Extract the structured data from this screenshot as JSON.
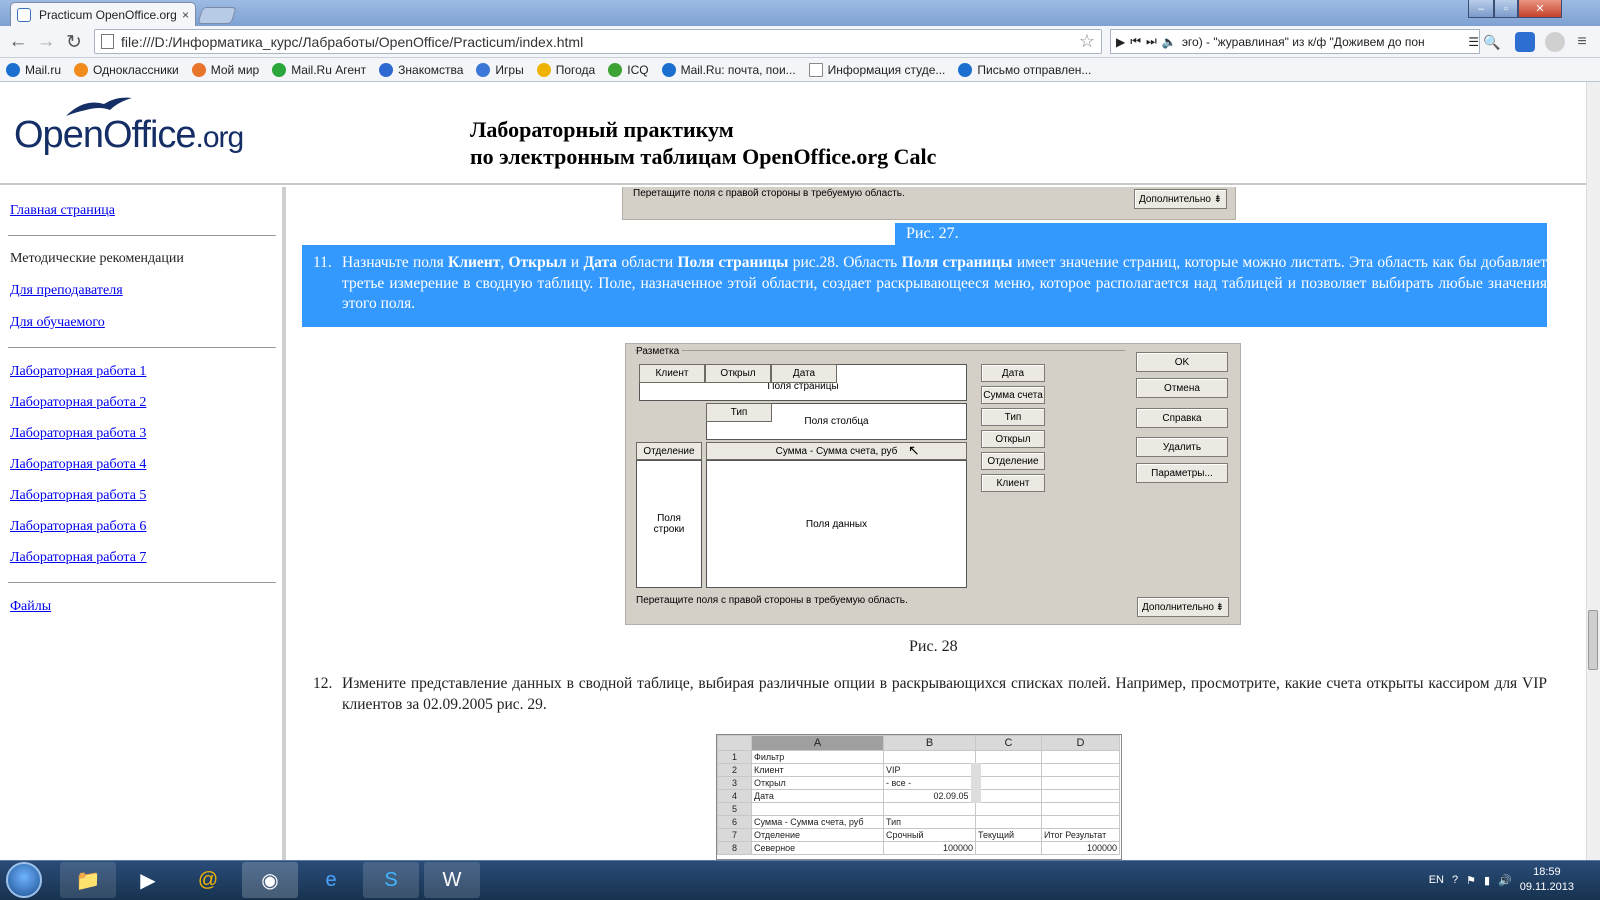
{
  "browser": {
    "tab_title": "Practicum OpenOffice.org",
    "tab_close": "×",
    "url": "file:///D:/Информатика_курс/Лабработы/OpenOffice/Practicum/index.html",
    "player_text": "эго) - \"журавлиная\" из к/ф \"Доживем до пон",
    "bookmarks": [
      {
        "label": "Mail.ru",
        "color": "#1a6fd1",
        "icon": "mail-icon"
      },
      {
        "label": "Одноклассники",
        "color": "#f08b1c",
        "icon": "ok-icon"
      },
      {
        "label": "Мой мир",
        "color": "#e9742b",
        "icon": "world-icon"
      },
      {
        "label": "Mail.Ru Агент",
        "color": "#2aa63a",
        "icon": "agent-icon"
      },
      {
        "label": "Знакомства",
        "color": "#2e6ad1",
        "icon": "at-icon"
      },
      {
        "label": "Игры",
        "color": "#3b77d8",
        "icon": "games-icon"
      },
      {
        "label": "Погода",
        "color": "#f0b400",
        "icon": "weather-icon"
      },
      {
        "label": "ICQ",
        "color": "#3da234",
        "icon": "icq-icon"
      },
      {
        "label": "Mail.Ru: почта, пои...",
        "color": "#1a6fd1",
        "icon": "mail-icon"
      },
      {
        "label": "Информация студе...",
        "color": "#ffffff",
        "icon": "page-icon"
      },
      {
        "label": "Письмо отправлен...",
        "color": "#1a6fd1",
        "icon": "mail-icon"
      }
    ]
  },
  "header": {
    "logo_word": "OpenOffice",
    "logo_suffix": ".org",
    "title_line1": "Лабораторный практикум",
    "title_line2": "по электронным таблицам OpenOffice.org Calc"
  },
  "sidebar": {
    "home": "Главная страница",
    "methodics": "Методические рекомендации",
    "teacher": "Для преподавателя",
    "student": "Для обучаемого",
    "labs": [
      "Лабораторная работа 1",
      "Лабораторная работа 2",
      "Лабораторная работа 3",
      "Лабораторная работа 4",
      "Лабораторная работа 5",
      "Лабораторная работа 6",
      "Лабораторная работа 7"
    ],
    "files": "Файлы"
  },
  "content": {
    "top_dialog_hint": "Перетащите поля с правой стороны в требуемую область.",
    "top_dialog_more": "Дополнительно",
    "caption27": "Рис. 27.",
    "item11_num": "11.",
    "item11_p1": "Назначьте поля ",
    "item11_b1": "Клиент",
    "item11_p2": ", ",
    "item11_b2": "Открыл",
    "item11_p3": " и ",
    "item11_b3": "Дата",
    "item11_p4": " области ",
    "item11_b4": "Поля страницы",
    "item11_p5": " рис.28. Область ",
    "item11_b5": "Поля страницы",
    "item11_p6": " имеет значение страниц, которые можно листать. Эта область как бы добавляет третье измерение в сводную таблицу. Поле, назначенное этой области, создает раскрывающееся меню, которое располагается над таблицей и позволяет выбирать любые значения этого поля.",
    "dialog": {
      "legend": "Разметка",
      "page_fields": [
        "Клиент",
        "Открыл",
        "Дата"
      ],
      "page_zone": "Поля страницы",
      "col_field": "Тип",
      "col_zone": "Поля столбца",
      "row_field": "Отделение",
      "data_field": "Сумма -  Сумма счета, руб",
      "row_zone_1": "Поля",
      "row_zone_2": "строки",
      "data_zone": "Поля данных",
      "available": [
        "Дата",
        "Сумма счета",
        "Тип",
        "Открыл",
        "Отделение",
        "Клиент"
      ],
      "ok": "OK",
      "cancel": "Отмена",
      "help": "Справка",
      "delete": "Удалить",
      "options": "Параметры...",
      "hint": "Перетащите поля с правой стороны в требуемую область.",
      "more": "Дополнительно"
    },
    "caption28": "Рис. 28",
    "item12_num": "12.",
    "item12_text": "Измените представление данных в сводной таблице, выбирая различные опции в раскрывающихся списках полей. Например, просмотрите, какие счета открыты кассиром для VIP клиентов за 02.09.2005 рис. 29.",
    "sheet": {
      "cols": [
        "A",
        "B",
        "C",
        "D"
      ],
      "rows": [
        [
          "1",
          "Фильтр",
          "",
          "",
          ""
        ],
        [
          "2",
          "Клиент",
          "VIP",
          "",
          ""
        ],
        [
          "3",
          "Открыл",
          "- все -",
          "",
          ""
        ],
        [
          "4",
          "Дата",
          "02.09.05",
          "",
          ""
        ],
        [
          "5",
          "",
          "",
          "",
          ""
        ],
        [
          "6",
          "Сумма -  Сумма счета, руб",
          "Тип",
          "",
          ""
        ],
        [
          "7",
          "Отделение",
          "Срочный",
          "Текущий",
          "Итог Результат"
        ],
        [
          "8",
          "Северное",
          "100000",
          "",
          "100000"
        ]
      ]
    }
  },
  "taskbar": {
    "lang": "EN",
    "time": "18:59",
    "date": "09.11.2013"
  }
}
